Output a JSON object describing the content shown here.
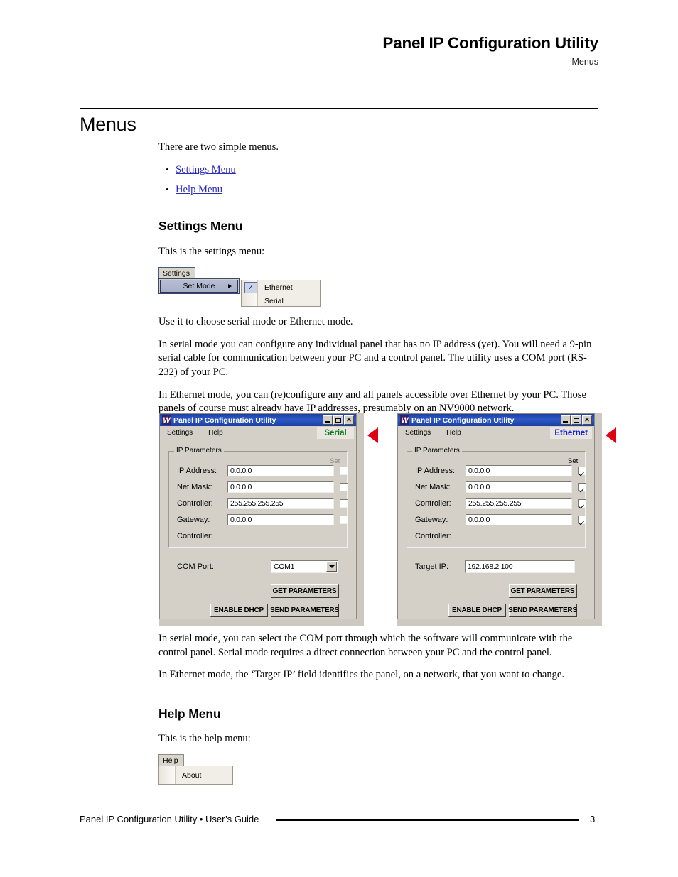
{
  "header": {
    "title": "Panel IP Configuration Utility",
    "subtitle": "Menus"
  },
  "page_title": "Menus",
  "intro": {
    "lead": "There are two simple menus.",
    "links": [
      {
        "label": "Settings Menu"
      },
      {
        "label": "Help Menu"
      }
    ]
  },
  "settings_section": {
    "heading": "Settings Menu",
    "caption": "This is the settings menu:",
    "menu_mock": {
      "menubar_label": "Settings",
      "item_label": "Set Mode",
      "submenu": [
        {
          "label": "Ethernet",
          "checked": true
        },
        {
          "label": "Serial",
          "checked": false
        }
      ]
    },
    "paragraphs": [
      "Use it to choose serial mode or Ethernet mode.",
      "In serial mode you can configure any individual panel that has no IP address (yet). You will need a 9-pin serial cable for communication between your PC and a control panel. The utility uses a COM port (RS-232) of your PC.",
      "In Ethernet mode, you can (re)configure any and all panels accessible over Ethernet by your PC. Those panels of course must already have IP addresses, presumably on an NV9000 network."
    ],
    "after_paragraphs": [
      "In serial mode, you can select the COM port through which the software will communicate with the control panel. Serial mode requires a direct connection between your PC and the control panel.",
      "In Ethernet mode, the ‘Target IP’ field identifies the panel, on a network, that you want to change."
    ]
  },
  "dialogs": {
    "serial": {
      "window_title": "Panel IP Configuration Utility",
      "app_icon": "app-logo-icon",
      "window_buttons": [
        "minimize-icon",
        "maximize-icon",
        "close-icon"
      ],
      "menus": [
        "Settings",
        "Help"
      ],
      "mode_label": "Serial",
      "mode_color": "#0a7a1e",
      "group_title": "IP Parameters",
      "set_column_label": "Set",
      "set_column_enabled": false,
      "fields": [
        {
          "label": "IP Address:",
          "value": "0.0.0.0",
          "checked": false
        },
        {
          "label": "Net Mask:",
          "value": "0.0.0.0",
          "checked": false
        },
        {
          "label": "Controller:",
          "value": "255.255.255.255",
          "checked": false
        },
        {
          "label": "Gateway:",
          "value": "0.0.0.0",
          "checked": false
        }
      ],
      "controller_label": "Controller:",
      "bottom_field": {
        "label": "COM Port:",
        "value": "COM1",
        "type": "combo"
      },
      "buttons": {
        "get": "GET PARAMETERS",
        "dhcp": "ENABLE DHCP",
        "send": "SEND PARAMETERS"
      }
    },
    "ethernet": {
      "window_title": "Panel IP Configuration Utility",
      "app_icon": "app-logo-icon",
      "window_buttons": [
        "minimize-icon",
        "maximize-icon",
        "close-icon"
      ],
      "menus": [
        "Settings",
        "Help"
      ],
      "mode_label": "Ethernet",
      "mode_color": "#1a1ad6",
      "group_title": "IP Parameters",
      "set_column_label": "Set",
      "set_column_enabled": true,
      "fields": [
        {
          "label": "IP Address:",
          "value": "0.0.0.0",
          "checked": true
        },
        {
          "label": "Net Mask:",
          "value": "0.0.0.0",
          "checked": true
        },
        {
          "label": "Controller:",
          "value": "255.255.255.255",
          "checked": true
        },
        {
          "label": "Gateway:",
          "value": "0.0.0.0",
          "checked": true
        }
      ],
      "controller_label": "Controller:",
      "bottom_field": {
        "label": "Target IP:",
        "value": "192.168.2.100",
        "type": "text"
      },
      "buttons": {
        "get": "GET PARAMETERS",
        "dhcp": "ENABLE DHCP",
        "send": "SEND PARAMETERS"
      }
    }
  },
  "help_section": {
    "heading": "Help Menu",
    "caption": "This is the help menu:",
    "menu_mock": {
      "menubar_label": "Help",
      "items": [
        {
          "label": "About"
        }
      ]
    }
  },
  "footer": {
    "text": "Panel IP Configuration Utility • User’s Guide",
    "page_number": "3"
  }
}
